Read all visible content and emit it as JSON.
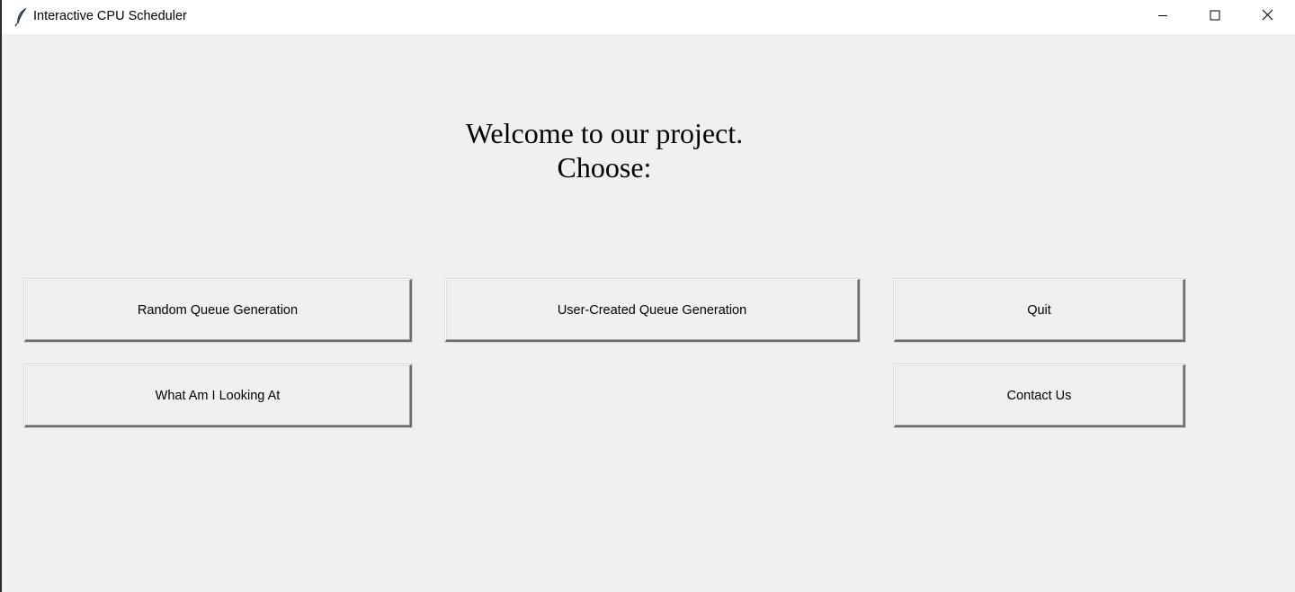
{
  "window": {
    "title": "Interactive CPU Scheduler",
    "app_icon": "feather-icon",
    "controls": [
      "minimize-icon",
      "maximize-icon",
      "close-icon"
    ]
  },
  "main": {
    "heading_line1": "Welcome to our project.",
    "heading_line2": "Choose:",
    "buttons": {
      "random_queue": "Random Queue Generation",
      "user_queue": "User-Created Queue Generation",
      "quit": "Quit",
      "what_am_i_looking_at": "What Am I Looking At",
      "contact_us": "Contact Us"
    }
  },
  "colors": {
    "background": "#f0f0f0",
    "titlebar": "#ffffff",
    "text": "#000000"
  }
}
